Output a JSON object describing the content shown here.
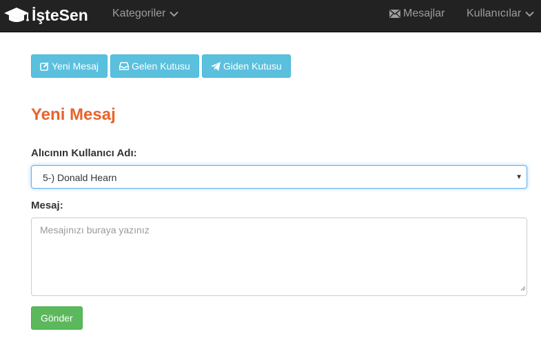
{
  "navbar": {
    "brand": "İşteSen",
    "kategoriler": "Kategoriler",
    "mesajlar": "Mesajlar",
    "kullanicilar": "Kullanıcılar"
  },
  "toolbar": {
    "yeni_mesaj": "Yeni Mesaj",
    "gelen_kutusu": "Gelen Kutusu",
    "giden_kutusu": "Giden Kutusu"
  },
  "page": {
    "title": "Yeni Mesaj"
  },
  "form": {
    "recipient_label": "Alıcının Kullanıcı Adı:",
    "recipient_value": "5-) Donald Hearn",
    "message_label": "Mesaj:",
    "message_placeholder": "Mesajınızı buraya yazınız",
    "submit_label": "Gönder"
  },
  "colors": {
    "navbar_bg": "#222222",
    "info": "#5bc0de",
    "success": "#5cb85c",
    "title": "#e8632b"
  }
}
